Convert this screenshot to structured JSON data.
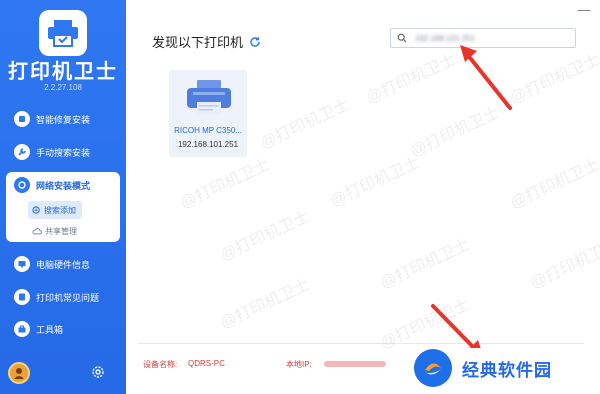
{
  "app": {
    "title": "打印机卫士",
    "version": "2.2.27.108"
  },
  "sidebar": {
    "items": [
      {
        "label": "智能修复安装",
        "icon": "wrench-shield-icon"
      },
      {
        "label": "手动搜索安装",
        "icon": "wrench-icon"
      },
      {
        "label": "网络安装模式",
        "icon": "network-icon"
      },
      {
        "label": "电脑硬件信息",
        "icon": "monitor-icon"
      },
      {
        "label": "打印机常见问题",
        "icon": "question-icon"
      },
      {
        "label": "工具箱",
        "icon": "toolbox-icon"
      }
    ],
    "sub_items": [
      {
        "label": "搜索添加",
        "icon": "search-plus-icon"
      },
      {
        "label": "共享管理",
        "icon": "cloud-icon"
      }
    ]
  },
  "main": {
    "heading": "发现以下打印机",
    "search_value": "192.168.101.251",
    "printer": {
      "name": "RICOH MP C350...",
      "ip": "192.168.101.251"
    },
    "footer": {
      "device_label": "设备名称:",
      "device_value": "QDRS-PC",
      "ip_label": "本地IP:"
    },
    "close_symbol": "—",
    "watermark": "@打印机卫士"
  },
  "badge": {
    "text": "经典软件园"
  },
  "colors": {
    "sidebar": "#2f78f2",
    "accent": "#2569e6",
    "footer_text": "#d73a3a",
    "arrow": "#e8352a"
  }
}
